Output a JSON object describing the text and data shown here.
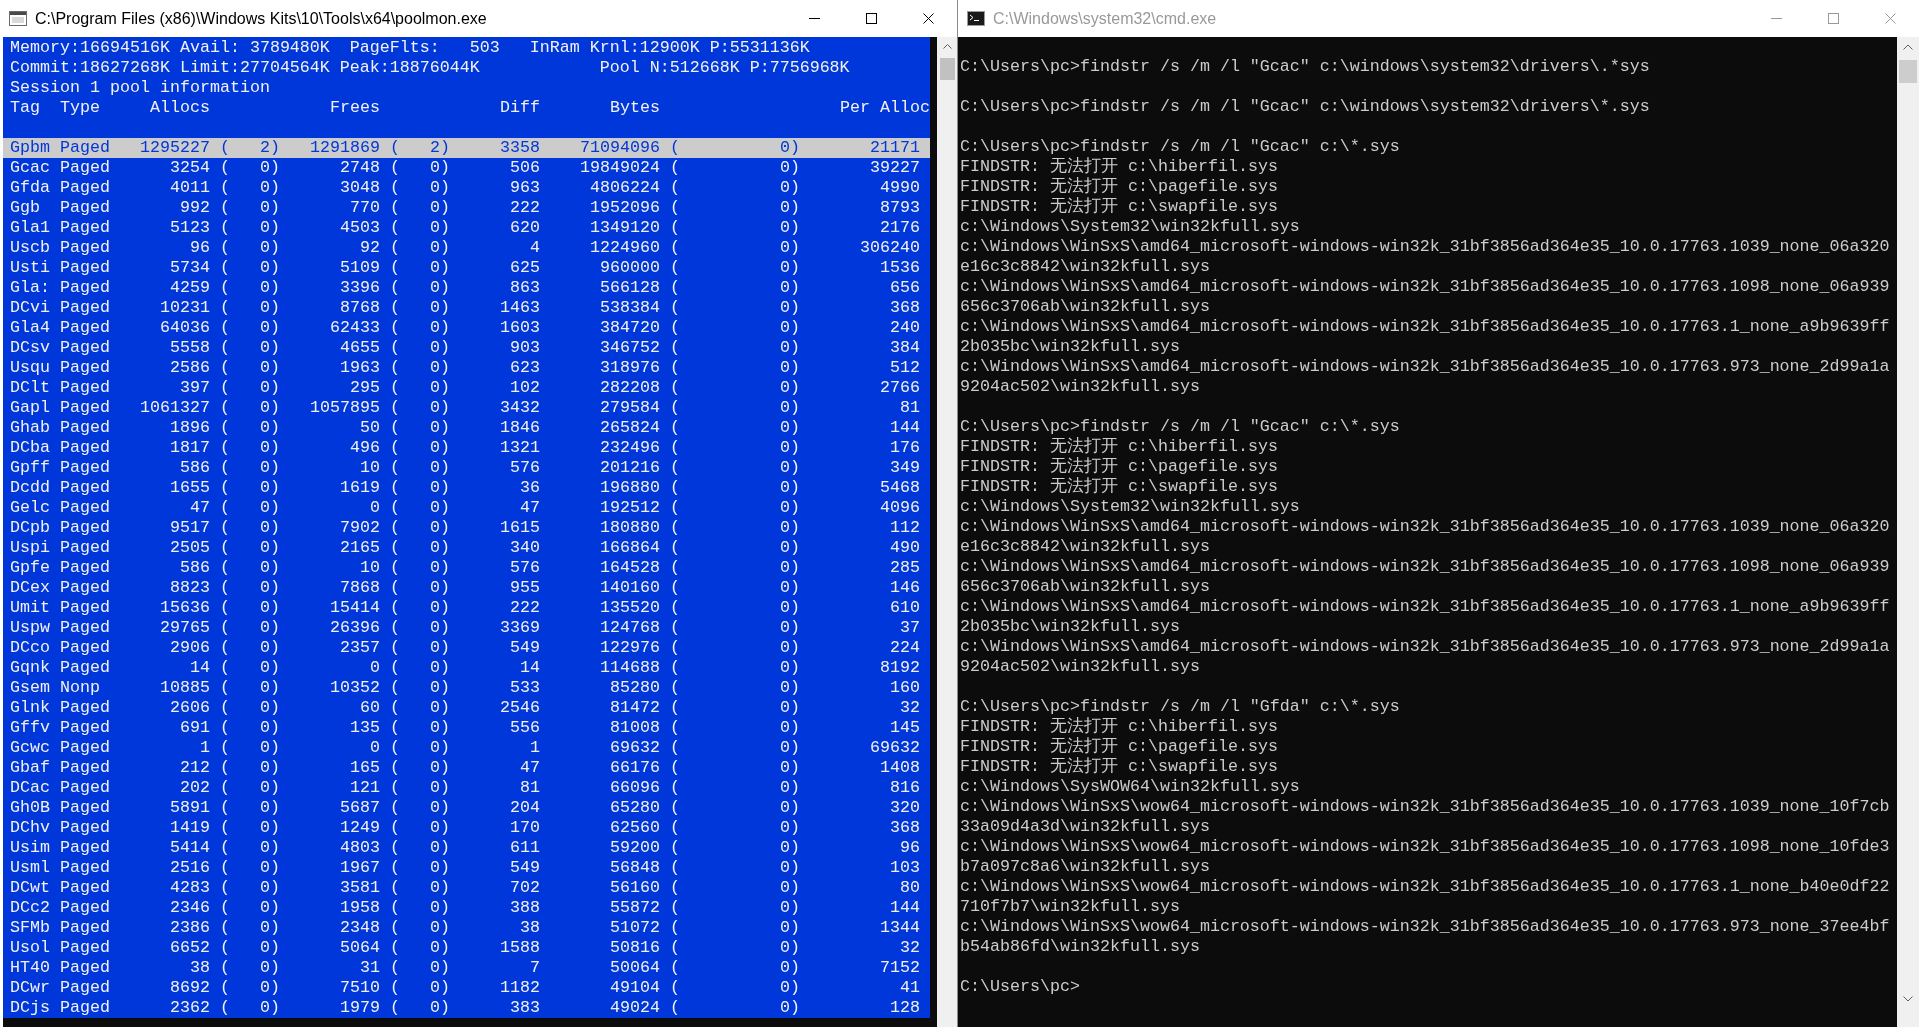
{
  "windows": [
    {
      "kind": "poolmon",
      "title": "C:\\Program Files (x86)\\Windows Kits\\10\\Tools\\x64\\poolmon.exe",
      "active": true,
      "status_lines": [
        "Memory:16694516K Avail: 3789480K  PageFlts:   503   InRam Krnl:12900K P:5531136K",
        "Commit:18627268K Limit:27704564K Peak:18876044K            Pool N:512668K P:7756968K",
        "Session 1 pool information"
      ],
      "columns": [
        "Tag",
        "Type",
        "Allocs",
        "",
        "Frees",
        "",
        "Diff",
        "Bytes",
        "",
        "Per Alloc"
      ],
      "rows": [
        {
          "cells": [
            "Gpbm",
            "Paged",
            "1295227",
            "(   2)",
            "1291869",
            "(   2)",
            "3358",
            "71094096",
            "(          0)",
            "21171"
          ],
          "selected": true
        },
        {
          "cells": [
            "Gcac",
            "Paged",
            "3254",
            "(   0)",
            "2748",
            "(   0)",
            "506",
            "19849024",
            "(          0)",
            "39227"
          ],
          "selected": false
        },
        {
          "cells": [
            "Gfda",
            "Paged",
            "4011",
            "(   0)",
            "3048",
            "(   0)",
            "963",
            "4806224",
            "(          0)",
            "4990"
          ],
          "selected": false
        },
        {
          "cells": [
            "Ggb",
            "Paged",
            "992",
            "(   0)",
            "770",
            "(   0)",
            "222",
            "1952096",
            "(          0)",
            "8793"
          ],
          "selected": false
        },
        {
          "cells": [
            "Gla1",
            "Paged",
            "5123",
            "(   0)",
            "4503",
            "(   0)",
            "620",
            "1349120",
            "(          0)",
            "2176"
          ],
          "selected": false
        },
        {
          "cells": [
            "Uscb",
            "Paged",
            "96",
            "(   0)",
            "92",
            "(   0)",
            "4",
            "1224960",
            "(          0)",
            "306240"
          ],
          "selected": false
        },
        {
          "cells": [
            "Usti",
            "Paged",
            "5734",
            "(   0)",
            "5109",
            "(   0)",
            "625",
            "960000",
            "(          0)",
            "1536"
          ],
          "selected": false
        },
        {
          "cells": [
            "Gla:",
            "Paged",
            "4259",
            "(   0)",
            "3396",
            "(   0)",
            "863",
            "566128",
            "(          0)",
            "656"
          ],
          "selected": false
        },
        {
          "cells": [
            "DCvi",
            "Paged",
            "10231",
            "(   0)",
            "8768",
            "(   0)",
            "1463",
            "538384",
            "(          0)",
            "368"
          ],
          "selected": false
        },
        {
          "cells": [
            "Gla4",
            "Paged",
            "64036",
            "(   0)",
            "62433",
            "(   0)",
            "1603",
            "384720",
            "(          0)",
            "240"
          ],
          "selected": false
        },
        {
          "cells": [
            "DCsv",
            "Paged",
            "5558",
            "(   0)",
            "4655",
            "(   0)",
            "903",
            "346752",
            "(          0)",
            "384"
          ],
          "selected": false
        },
        {
          "cells": [
            "Usqu",
            "Paged",
            "2586",
            "(   0)",
            "1963",
            "(   0)",
            "623",
            "318976",
            "(          0)",
            "512"
          ],
          "selected": false
        },
        {
          "cells": [
            "DClt",
            "Paged",
            "397",
            "(   0)",
            "295",
            "(   0)",
            "102",
            "282208",
            "(          0)",
            "2766"
          ],
          "selected": false
        },
        {
          "cells": [
            "Gapl",
            "Paged",
            "1061327",
            "(   0)",
            "1057895",
            "(   0)",
            "3432",
            "279584",
            "(          0)",
            "81"
          ],
          "selected": false
        },
        {
          "cells": [
            "Ghab",
            "Paged",
            "1896",
            "(   0)",
            "50",
            "(   0)",
            "1846",
            "265824",
            "(          0)",
            "144"
          ],
          "selected": false
        },
        {
          "cells": [
            "DCba",
            "Paged",
            "1817",
            "(   0)",
            "496",
            "(   0)",
            "1321",
            "232496",
            "(          0)",
            "176"
          ],
          "selected": false
        },
        {
          "cells": [
            "Gpff",
            "Paged",
            "586",
            "(   0)",
            "10",
            "(   0)",
            "576",
            "201216",
            "(          0)",
            "349"
          ],
          "selected": false
        },
        {
          "cells": [
            "Dcdd",
            "Paged",
            "1655",
            "(   0)",
            "1619",
            "(   0)",
            "36",
            "196880",
            "(          0)",
            "5468"
          ],
          "selected": false
        },
        {
          "cells": [
            "Gelc",
            "Paged",
            "47",
            "(   0)",
            "0",
            "(   0)",
            "47",
            "192512",
            "(          0)",
            "4096"
          ],
          "selected": false
        },
        {
          "cells": [
            "DCpb",
            "Paged",
            "9517",
            "(   0)",
            "7902",
            "(   0)",
            "1615",
            "180880",
            "(          0)",
            "112"
          ],
          "selected": false
        },
        {
          "cells": [
            "Uspi",
            "Paged",
            "2505",
            "(   0)",
            "2165",
            "(   0)",
            "340",
            "166864",
            "(          0)",
            "490"
          ],
          "selected": false
        },
        {
          "cells": [
            "Gpfe",
            "Paged",
            "586",
            "(   0)",
            "10",
            "(   0)",
            "576",
            "164528",
            "(          0)",
            "285"
          ],
          "selected": false
        },
        {
          "cells": [
            "DCex",
            "Paged",
            "8823",
            "(   0)",
            "7868",
            "(   0)",
            "955",
            "140160",
            "(          0)",
            "146"
          ],
          "selected": false
        },
        {
          "cells": [
            "Umit",
            "Paged",
            "15636",
            "(   0)",
            "15414",
            "(   0)",
            "222",
            "135520",
            "(          0)",
            "610"
          ],
          "selected": false
        },
        {
          "cells": [
            "Uspw",
            "Paged",
            "29765",
            "(   0)",
            "26396",
            "(   0)",
            "3369",
            "124768",
            "(          0)",
            "37"
          ],
          "selected": false
        },
        {
          "cells": [
            "DCco",
            "Paged",
            "2906",
            "(   0)",
            "2357",
            "(   0)",
            "549",
            "122976",
            "(          0)",
            "224"
          ],
          "selected": false
        },
        {
          "cells": [
            "Gqnk",
            "Paged",
            "14",
            "(   0)",
            "0",
            "(   0)",
            "14",
            "114688",
            "(          0)",
            "8192"
          ],
          "selected": false
        },
        {
          "cells": [
            "Gsem",
            "Nonp",
            "10885",
            "(   0)",
            "10352",
            "(   0)",
            "533",
            "85280",
            "(          0)",
            "160"
          ],
          "selected": false
        },
        {
          "cells": [
            "Glnk",
            "Paged",
            "2606",
            "(   0)",
            "60",
            "(   0)",
            "2546",
            "81472",
            "(          0)",
            "32"
          ],
          "selected": false
        },
        {
          "cells": [
            "Gffv",
            "Paged",
            "691",
            "(   0)",
            "135",
            "(   0)",
            "556",
            "81008",
            "(          0)",
            "145"
          ],
          "selected": false
        },
        {
          "cells": [
            "Gcwc",
            "Paged",
            "1",
            "(   0)",
            "0",
            "(   0)",
            "1",
            "69632",
            "(          0)",
            "69632"
          ],
          "selected": false
        },
        {
          "cells": [
            "Gbaf",
            "Paged",
            "212",
            "(   0)",
            "165",
            "(   0)",
            "47",
            "66176",
            "(          0)",
            "1408"
          ],
          "selected": false
        },
        {
          "cells": [
            "DCac",
            "Paged",
            "202",
            "(   0)",
            "121",
            "(   0)",
            "81",
            "66096",
            "(          0)",
            "816"
          ],
          "selected": false
        },
        {
          "cells": [
            "Gh0B",
            "Paged",
            "5891",
            "(   0)",
            "5687",
            "(   0)",
            "204",
            "65280",
            "(          0)",
            "320"
          ],
          "selected": false
        },
        {
          "cells": [
            "DChv",
            "Paged",
            "1419",
            "(   0)",
            "1249",
            "(   0)",
            "170",
            "62560",
            "(          0)",
            "368"
          ],
          "selected": false
        },
        {
          "cells": [
            "Usim",
            "Paged",
            "5414",
            "(   0)",
            "4803",
            "(   0)",
            "611",
            "59200",
            "(          0)",
            "96"
          ],
          "selected": false
        },
        {
          "cells": [
            "Usml",
            "Paged",
            "2516",
            "(   0)",
            "1967",
            "(   0)",
            "549",
            "56848",
            "(          0)",
            "103"
          ],
          "selected": false
        },
        {
          "cells": [
            "DCwt",
            "Paged",
            "4283",
            "(   0)",
            "3581",
            "(   0)",
            "702",
            "56160",
            "(          0)",
            "80"
          ],
          "selected": false
        },
        {
          "cells": [
            "DCc2",
            "Paged",
            "2346",
            "(   0)",
            "1958",
            "(   0)",
            "388",
            "55872",
            "(          0)",
            "144"
          ],
          "selected": false
        },
        {
          "cells": [
            "SFMb",
            "Paged",
            "2386",
            "(   0)",
            "2348",
            "(   0)",
            "38",
            "51072",
            "(          0)",
            "1344"
          ],
          "selected": false
        },
        {
          "cells": [
            "Usol",
            "Paged",
            "6652",
            "(   0)",
            "5064",
            "(   0)",
            "1588",
            "50816",
            "(          0)",
            "32"
          ],
          "selected": false
        },
        {
          "cells": [
            "HT40",
            "Paged",
            "38",
            "(   0)",
            "31",
            "(   0)",
            "7",
            "50064",
            "(          0)",
            "7152"
          ],
          "selected": false
        },
        {
          "cells": [
            "DCwr",
            "Paged",
            "8692",
            "(   0)",
            "7510",
            "(   0)",
            "1182",
            "49104",
            "(          0)",
            "41"
          ],
          "selected": false
        },
        {
          "cells": [
            "DCjs",
            "Paged",
            "2362",
            "(   0)",
            "1979",
            "(   0)",
            "383",
            "49024",
            "(          0)",
            "128"
          ],
          "selected": false
        }
      ]
    },
    {
      "kind": "console",
      "title": "C:\\Windows\\system32\\cmd.exe",
      "active": false,
      "blocks": [
        {
          "command": "C:\\Users\\pc>findstr /s /m /l \"Gcac\" c:\\windows\\system32\\drivers\\.*sys"
        },
        {
          "command": "C:\\Users\\pc>findstr /s /m /l \"Gcac\" c:\\windows\\system32\\drivers\\*.sys"
        },
        {
          "command": "C:\\Users\\pc>findstr /s /m /l \"Gcac\" c:\\*.sys",
          "output": [
            "FINDSTR: 无法打开 c:\\hiberfil.sys",
            "FINDSTR: 无法打开 c:\\pagefile.sys",
            "FINDSTR: 无法打开 c:\\swapfile.sys",
            "c:\\Windows\\System32\\win32kfull.sys",
            "c:\\Windows\\WinSxS\\amd64_microsoft-windows-win32k_31bf3856ad364e35_10.0.17763.1039_none_06a320e16c3c8842\\win32kfull.sys",
            "c:\\Windows\\WinSxS\\amd64_microsoft-windows-win32k_31bf3856ad364e35_10.0.17763.1098_none_06a939656c3706ab\\win32kfull.sys",
            "c:\\Windows\\WinSxS\\amd64_microsoft-windows-win32k_31bf3856ad364e35_10.0.17763.1_none_a9b9639ff2b035bc\\win32kfull.sys",
            "c:\\Windows\\WinSxS\\amd64_microsoft-windows-win32k_31bf3856ad364e35_10.0.17763.973_none_2d99a1a9204ac502\\win32kfull.sys"
          ]
        },
        {
          "command": "C:\\Users\\pc>findstr /s /m /l \"Gcac\" c:\\*.sys",
          "output": [
            "FINDSTR: 无法打开 c:\\hiberfil.sys",
            "FINDSTR: 无法打开 c:\\pagefile.sys",
            "FINDSTR: 无法打开 c:\\swapfile.sys",
            "c:\\Windows\\System32\\win32kfull.sys",
            "c:\\Windows\\WinSxS\\amd64_microsoft-windows-win32k_31bf3856ad364e35_10.0.17763.1039_none_06a320e16c3c8842\\win32kfull.sys",
            "c:\\Windows\\WinSxS\\amd64_microsoft-windows-win32k_31bf3856ad364e35_10.0.17763.1098_none_06a939656c3706ab\\win32kfull.sys",
            "c:\\Windows\\WinSxS\\amd64_microsoft-windows-win32k_31bf3856ad364e35_10.0.17763.1_none_a9b9639ff2b035bc\\win32kfull.sys",
            "c:\\Windows\\WinSxS\\amd64_microsoft-windows-win32k_31bf3856ad364e35_10.0.17763.973_none_2d99a1a9204ac502\\win32kfull.sys"
          ]
        },
        {
          "command": "C:\\Users\\pc>findstr /s /m /l \"Gfda\" c:\\*.sys",
          "output": [
            "FINDSTR: 无法打开 c:\\hiberfil.sys",
            "FINDSTR: 无法打开 c:\\pagefile.sys",
            "FINDSTR: 无法打开 c:\\swapfile.sys",
            "c:\\Windows\\SysWOW64\\win32kfull.sys",
            "c:\\Windows\\WinSxS\\wow64_microsoft-windows-win32k_31bf3856ad364e35_10.0.17763.1039_none_10f7cb33a09d4a3d\\win32kfull.sys",
            "c:\\Windows\\WinSxS\\wow64_microsoft-windows-win32k_31bf3856ad364e35_10.0.17763.1098_none_10fde3b7a097c8a6\\win32kfull.sys",
            "c:\\Windows\\WinSxS\\wow64_microsoft-windows-win32k_31bf3856ad364e35_10.0.17763.1_none_b40e0df22710f7b7\\win32kfull.sys",
            "c:\\Windows\\WinSxS\\wow64_microsoft-windows-win32k_31bf3856ad364e35_10.0.17763.973_none_37ee4bfb54ab86fd\\win32kfull.sys"
          ]
        }
      ],
      "prompt": "C:\\Users\\pc>"
    }
  ]
}
